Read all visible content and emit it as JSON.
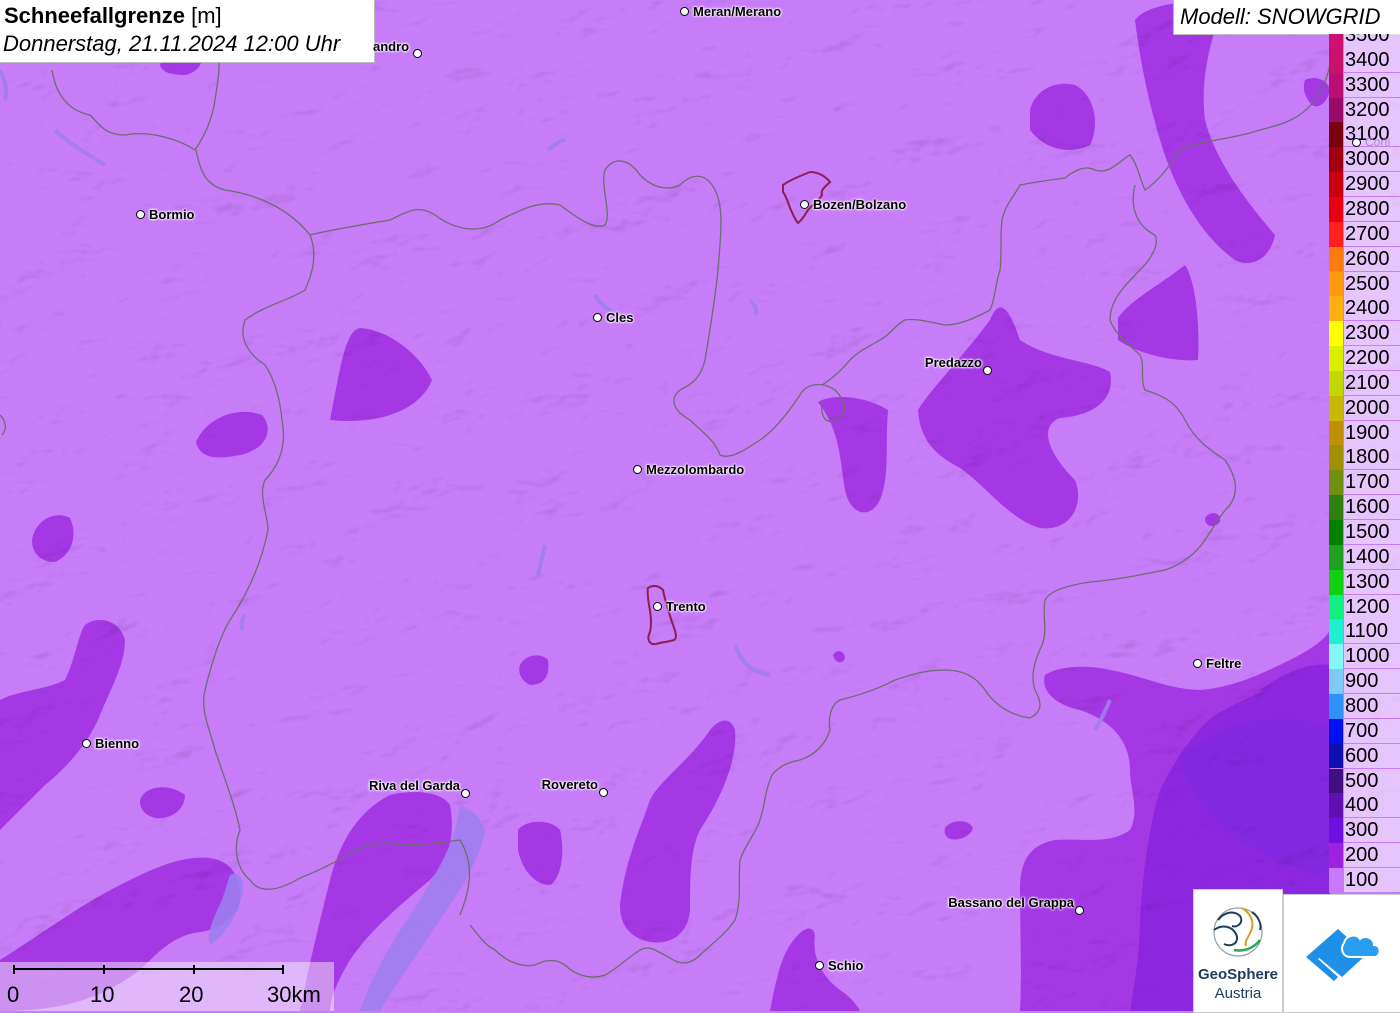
{
  "header": {
    "title_bold": "Schneefallgrenze",
    "title_unit": "[m]",
    "datetime": "Donnerstag, 21.11.2024 12:00 Uhr"
  },
  "model": {
    "label": "Modell: SNOWGRID"
  },
  "legend": {
    "entries": [
      {
        "label": "3500",
        "color": "#d01070"
      },
      {
        "label": "3400",
        "color": "#c8106e"
      },
      {
        "label": "3300",
        "color": "#b80f74"
      },
      {
        "label": "3200",
        "color": "#9a0a6a"
      },
      {
        "label": "3100",
        "color": "#7a0010"
      },
      {
        "label": "3000",
        "color": "#a00010"
      },
      {
        "label": "2900",
        "color": "#c80010"
      },
      {
        "label": "2800",
        "color": "#e80010"
      },
      {
        "label": "2700",
        "color": "#ff2020"
      },
      {
        "label": "2600",
        "color": "#ff7a10"
      },
      {
        "label": "2500",
        "color": "#ff9a10"
      },
      {
        "label": "2400",
        "color": "#ffb010"
      },
      {
        "label": "2300",
        "color": "#ffff00"
      },
      {
        "label": "2200",
        "color": "#d8f000"
      },
      {
        "label": "2100",
        "color": "#c0d800"
      },
      {
        "label": "2000",
        "color": "#c8b800"
      },
      {
        "label": "1900",
        "color": "#c09000"
      },
      {
        "label": "1800",
        "color": "#a09000"
      },
      {
        "label": "1700",
        "color": "#709010"
      },
      {
        "label": "1600",
        "color": "#308010"
      },
      {
        "label": "1500",
        "color": "#008000"
      },
      {
        "label": "1400",
        "color": "#20a020"
      },
      {
        "label": "1300",
        "color": "#10d010"
      },
      {
        "label": "1200",
        "color": "#10f080"
      },
      {
        "label": "1100",
        "color": "#20f0d0"
      },
      {
        "label": "1000",
        "color": "#80f8f8"
      },
      {
        "label": "900",
        "color": "#80c8f8"
      },
      {
        "label": "800",
        "color": "#3090f8"
      },
      {
        "label": "700",
        "color": "#0010f0"
      },
      {
        "label": "600",
        "color": "#1010b0"
      },
      {
        "label": "500",
        "color": "#401080"
      },
      {
        "label": "400",
        "color": "#6010b0"
      },
      {
        "label": "300",
        "color": "#7010e0"
      },
      {
        "label": "200",
        "color": "#a020e0"
      },
      {
        "label": "100",
        "color": "#c878f8"
      }
    ]
  },
  "cities": [
    {
      "name": "Meran/Merano",
      "anchor": "left"
    },
    {
      "name": "andro",
      "anchor": "right"
    },
    {
      "name": "Bormio",
      "anchor": "left"
    },
    {
      "name": "Bozen/Bolzano",
      "anchor": "left"
    },
    {
      "name": "Cles",
      "anchor": "left"
    },
    {
      "name": "Predazzo",
      "anchor": "right"
    },
    {
      "name": "Mezzolombardo",
      "anchor": "left"
    },
    {
      "name": "Trento",
      "anchor": "left"
    },
    {
      "name": "Feltre",
      "anchor": "left"
    },
    {
      "name": "Bienno",
      "anchor": "left"
    },
    {
      "name": "Riva del Garda",
      "anchor": "right"
    },
    {
      "name": "Rovereto",
      "anchor": "right"
    },
    {
      "name": "Bassano del Grappa",
      "anchor": "right"
    },
    {
      "name": "Schio",
      "anchor": "left"
    },
    {
      "name": "Corti",
      "anchor": "left"
    }
  ],
  "scale": {
    "labels": [
      "0",
      "10",
      "20",
      "30km"
    ]
  },
  "logos": {
    "geosphere_line1": "GeoSphere",
    "geosphere_line2": "Austria"
  },
  "colors": {
    "base_100": "#c77cf8",
    "zone_200": "#a535e3",
    "zone_300": "#8a22d8",
    "zone_400": "#7a1fd0",
    "border": "#6d6d6d",
    "city_outline": "#8b2050",
    "lake": "#9d7ef0"
  }
}
